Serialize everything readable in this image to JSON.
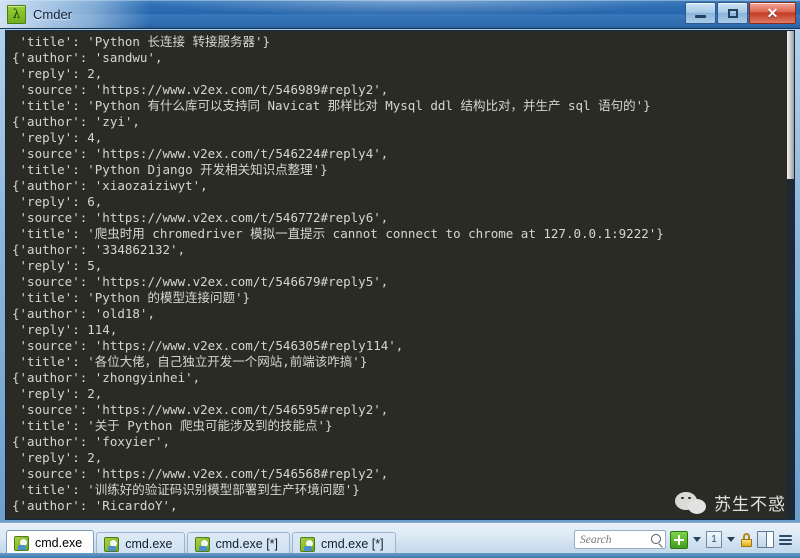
{
  "window": {
    "app_icon": "lambda-icon",
    "title": "Cmder",
    "buttons": {
      "minimize": "minimize-button",
      "maximize": "maximize-button",
      "close": "✕"
    }
  },
  "terminal": {
    "lines": [
      " 'title': 'Python 长连接 转接服务器'}",
      "{'author': 'sandwu',",
      " 'reply': 2,",
      " 'source': 'https://www.v2ex.com/t/546989#reply2',",
      " 'title': 'Python 有什么库可以支持同 Navicat 那样比对 Mysql ddl 结构比对，并生产 sql 语句的'}",
      "{'author': 'zyi',",
      " 'reply': 4,",
      " 'source': 'https://www.v2ex.com/t/546224#reply4',",
      " 'title': 'Python Django 开发相关知识点整理'}",
      "{'author': 'xiaozaiziwyt',",
      " 'reply': 6,",
      " 'source': 'https://www.v2ex.com/t/546772#reply6',",
      " 'title': '爬虫时用 chromedriver 模拟一直提示 cannot connect to chrome at 127.0.0.1:9222'}",
      "{'author': '334862132',",
      " 'reply': 5,",
      " 'source': 'https://www.v2ex.com/t/546679#reply5',",
      " 'title': 'Python 的模型连接问题'}",
      "{'author': 'old18',",
      " 'reply': 114,",
      " 'source': 'https://www.v2ex.com/t/546305#reply114',",
      " 'title': '各位大佬，自己独立开发一个网站,前端该咋搞'}",
      "{'author': 'zhongyinhei',",
      " 'reply': 2,",
      " 'source': 'https://www.v2ex.com/t/546595#reply2',",
      " 'title': '关于 Python 爬虫可能涉及到的技能点'}",
      "{'author': 'foxyier',",
      " 'reply': 2,",
      " 'source': 'https://www.v2ex.com/t/546568#reply2',",
      " 'title': '训练好的验证码识别模型部署到生产环境问题'}",
      "{'author': 'RicardoY',"
    ],
    "background_color": "#2b2b26",
    "text_color": "#d6d6d0",
    "watermark": "苏生不惑"
  },
  "statusbar": {
    "tabs": [
      {
        "label": "cmd.exe",
        "active": true
      },
      {
        "label": "cmd.exe",
        "active": false
      },
      {
        "label": "cmd.exe [*]",
        "active": false
      },
      {
        "label": "cmd.exe [*]",
        "active": false
      }
    ],
    "search": {
      "value": "",
      "placeholder": "Search"
    },
    "tools": [
      "new-tab-button",
      "new-tab-dropdown",
      "active-console-button",
      "console-dropdown",
      "lock-button",
      "panels-button",
      "menu-button"
    ]
  }
}
